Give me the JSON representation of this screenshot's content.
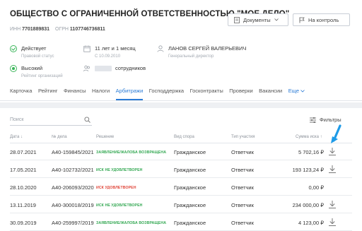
{
  "company": {
    "title": "ОБЩЕСТВО С ОГРАНИЧЕННОЙ ОТВЕТСТВЕННОСТЬЮ \"МОЕ ДЕЛО\"",
    "inn_label": "ИНН",
    "inn": "7701889831",
    "ogrn_label": "ОГРН",
    "ogrn": "1107746736811"
  },
  "actions": {
    "documents_label": "Документы",
    "control_label": "На контроль"
  },
  "info": {
    "status_value": "Действует",
    "status_label": "Правовой статус",
    "age_value": "11 лет и 1 месяц",
    "age_label": "С 10.09.2010",
    "director_value": "ЛАНОВ СЕРГЕЙ ВАЛЕРЬЕВИЧ",
    "director_label": "Генеральный директор",
    "rating_value": "Высокий",
    "rating_label": "Рейтинг организаций",
    "employees_value": "сотрудников"
  },
  "tabs": [
    "Карточка",
    "Рейтинг",
    "Финансы",
    "Налоги",
    "Арбитражи",
    "Господдержка",
    "Госконтракты",
    "Проверки",
    "Вакансии"
  ],
  "tabs_more": "Еще",
  "search": {
    "placeholder": "Поиск"
  },
  "filters_label": "Фильтры",
  "table": {
    "headers": {
      "date": "Дата ↓",
      "number": "№ дела",
      "result": "Решение",
      "kind": "Вид спора",
      "role": "Тип участия",
      "sum": "Сумма иска ↑"
    },
    "rows": [
      {
        "date": "28.07.2021",
        "number": "А40-159845/2021",
        "result": "ЗАЯВЛЕНИЕ/ЖАЛОБА ВОЗВРАЩЕНА",
        "result_color": "green",
        "kind": "Гражданское",
        "role": "Ответчик",
        "sum": "5 702,16 ₽"
      },
      {
        "date": "17.05.2021",
        "number": "А40-102732/2021",
        "result": "ИСК НЕ УДОВЛЕТВОРЕН",
        "result_color": "green",
        "kind": "Гражданское",
        "role": "Ответчик",
        "sum": "193 123,24 ₽"
      },
      {
        "date": "28.10.2020",
        "number": "А40-206093/2020",
        "result": "ИСК УДОВЛЕТВОРЕН",
        "result_color": "red",
        "kind": "Гражданское",
        "role": "Ответчик",
        "sum": "0,00 ₽"
      },
      {
        "date": "13.11.2019",
        "number": "А40-300018/2019",
        "result": "ИСК НЕ УДОВЛЕТВОРЕН",
        "result_color": "green",
        "kind": "Гражданское",
        "role": "Ответчик",
        "sum": "234 000,00 ₽"
      },
      {
        "date": "30.09.2019",
        "number": "А40-259997/2019",
        "result": "ЗАЯВЛЕНИЕ/ЖАЛОБА ВОЗВРАЩЕНА",
        "result_color": "green",
        "kind": "Гражданское",
        "role": "Ответчик",
        "sum": "4 123,00 ₽"
      }
    ]
  },
  "colors": {
    "accent": "#2a7bd6",
    "success": "#34a853",
    "danger": "#e0463a"
  }
}
